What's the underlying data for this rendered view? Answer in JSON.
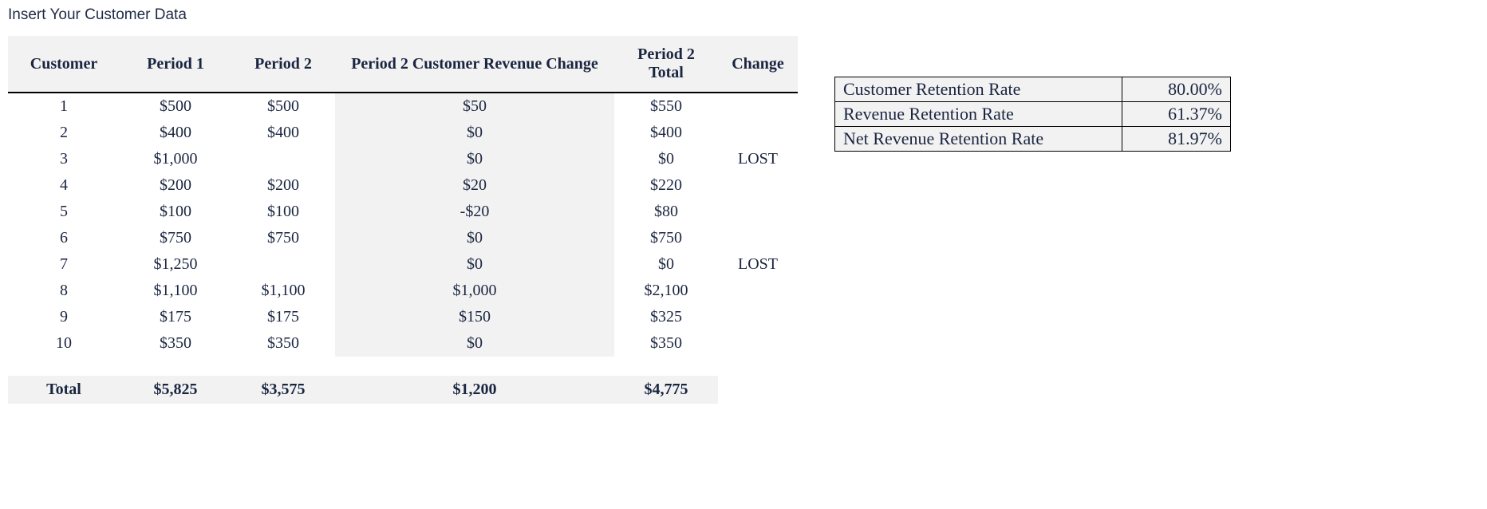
{
  "title": "Insert Your Customer Data",
  "headers": {
    "customer": "Customer",
    "period1": "Period 1",
    "period2": "Period 2",
    "rev_change": "Period 2 Customer Revenue Change",
    "total": "Period 2 Total",
    "change": "Change"
  },
  "rows": [
    {
      "customer": "1",
      "p1": "$500",
      "p2": "$500",
      "rev": "$50",
      "total": "$550",
      "change": ""
    },
    {
      "customer": "2",
      "p1": "$400",
      "p2": "$400",
      "rev": "$0",
      "total": "$400",
      "change": ""
    },
    {
      "customer": "3",
      "p1": "$1,000",
      "p2": "",
      "rev": "$0",
      "total": "$0",
      "change": "LOST"
    },
    {
      "customer": "4",
      "p1": "$200",
      "p2": "$200",
      "rev": "$20",
      "total": "$220",
      "change": ""
    },
    {
      "customer": "5",
      "p1": "$100",
      "p2": "$100",
      "rev": "-$20",
      "total": "$80",
      "change": ""
    },
    {
      "customer": "6",
      "p1": "$750",
      "p2": "$750",
      "rev": "$0",
      "total": "$750",
      "change": ""
    },
    {
      "customer": "7",
      "p1": "$1,250",
      "p2": "",
      "rev": "$0",
      "total": "$0",
      "change": "LOST"
    },
    {
      "customer": "8",
      "p1": "$1,100",
      "p2": "$1,100",
      "rev": "$1,000",
      "total": "$2,100",
      "change": ""
    },
    {
      "customer": "9",
      "p1": "$175",
      "p2": "$175",
      "rev": "$150",
      "total": "$325",
      "change": ""
    },
    {
      "customer": "10",
      "p1": "$350",
      "p2": "$350",
      "rev": "$0",
      "total": "$350",
      "change": ""
    }
  ],
  "totals": {
    "label": "Total",
    "p1": "$5,825",
    "p2": "$3,575",
    "rev": "$1,200",
    "total": "$4,775",
    "change": ""
  },
  "metrics": [
    {
      "label": "Customer Retention Rate",
      "value": "80.00%"
    },
    {
      "label": "Revenue Retention Rate",
      "value": "61.37%"
    },
    {
      "label": "Net Revenue Retention Rate",
      "value": "81.97%"
    }
  ]
}
